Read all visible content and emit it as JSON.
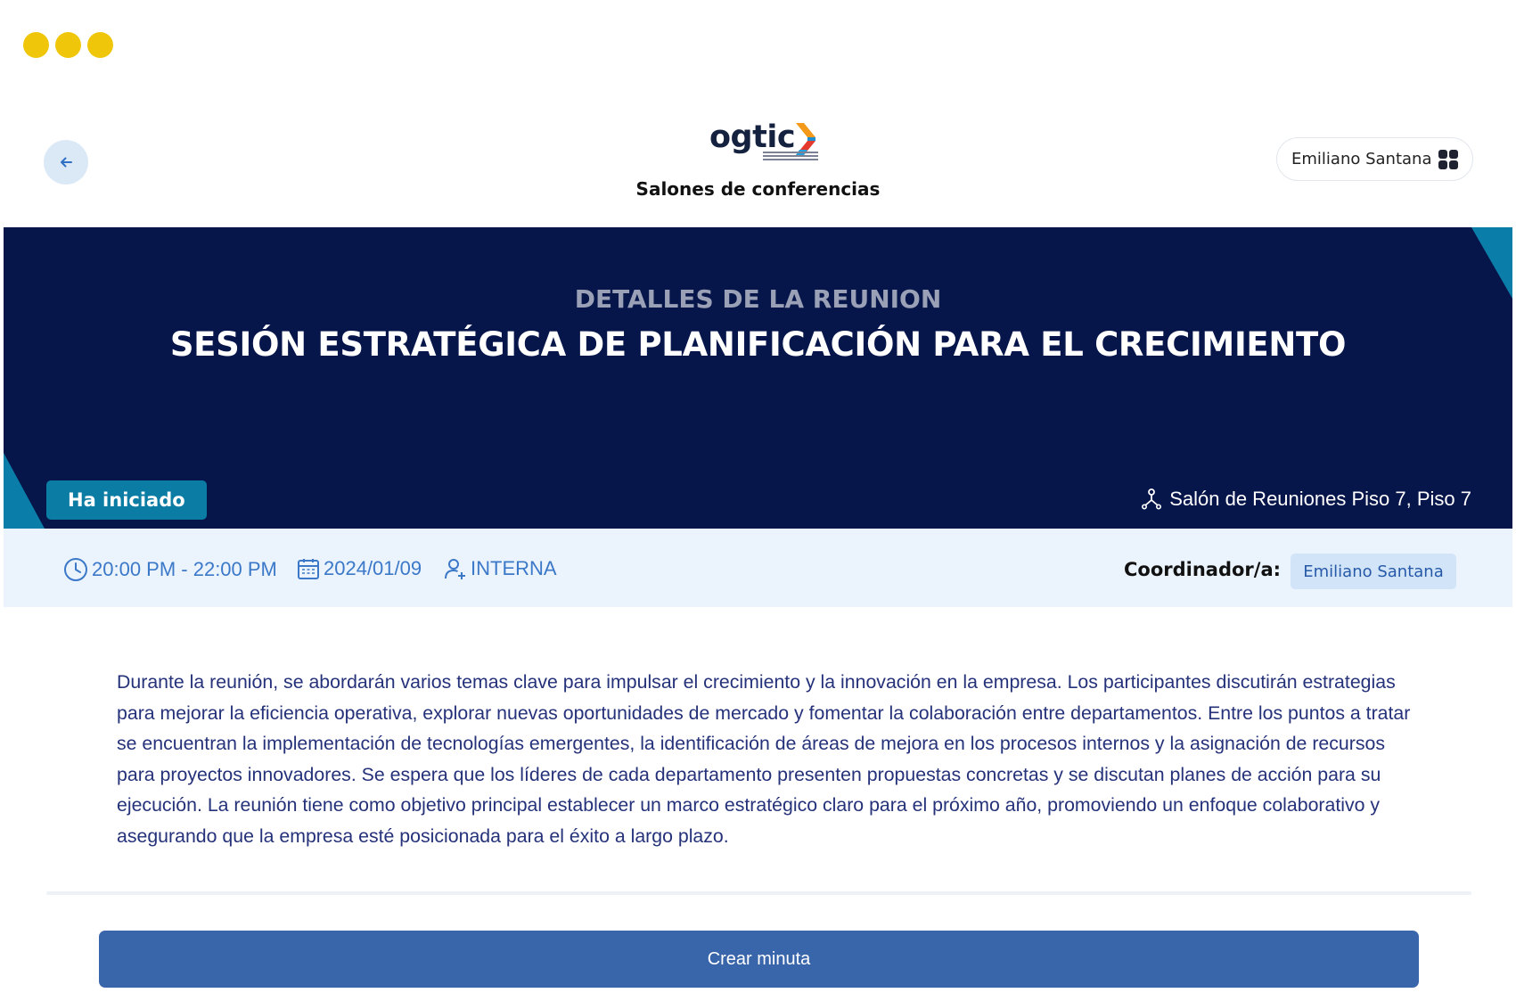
{
  "app": {
    "logo_text": "ogtic",
    "subtitle": "Salones de conferencias",
    "colors": {
      "window_dots": "#efc609",
      "hero_bg": "#06154a",
      "accent_teal": "#0a7ea8",
      "meta_bg": "#ebf4fd",
      "link_blue": "#3b78c8",
      "button_bg": "#3965ab"
    }
  },
  "header": {
    "back_icon": "arrow-left-icon",
    "user_name": "Emiliano Santana",
    "user_menu_icon": "grid-apps-icon"
  },
  "meeting": {
    "kicker": "DETALLES DE LA REUNION",
    "title": "SESIÓN ESTRATÉGICA DE PLANIFICACIÓN PARA EL CRECIMIENTO",
    "status": "Ha iniciado",
    "location": "Salón de Reuniones Piso 7, Piso 7",
    "location_icon": "network-node-icon",
    "time": "20:00 PM - 22:00 PM",
    "time_icon": "clock-icon",
    "date": "2024/01/09",
    "date_icon": "calendar-icon",
    "type": "INTERNA",
    "type_icon": "user-add-icon",
    "coordinator_label": "Coordinador/a:",
    "coordinator_name": "Emiliano Santana",
    "description": "Durante la reunión, se abordarán varios temas clave para impulsar el crecimiento y la innovación en la empresa. Los participantes discutirán estrategias para mejorar la eficiencia operativa, explorar nuevas oportunidades de mercado y fomentar la colaboración entre departamentos. Entre los puntos a tratar se encuentran la implementación de tecnologías emergentes, la identificación de áreas de mejora en los procesos internos y la asignación de recursos para proyectos innovadores. Se espera que los líderes de cada departamento presenten propuestas concretas y se discutan planes de acción para su ejecución. La reunión tiene como objetivo principal establecer un marco estratégico claro para el próximo año, promoviendo un enfoque colaborativo y asegurando que la empresa esté posicionada para el éxito a largo plazo."
  },
  "actions": {
    "create_minutes": "Crear minuta"
  }
}
